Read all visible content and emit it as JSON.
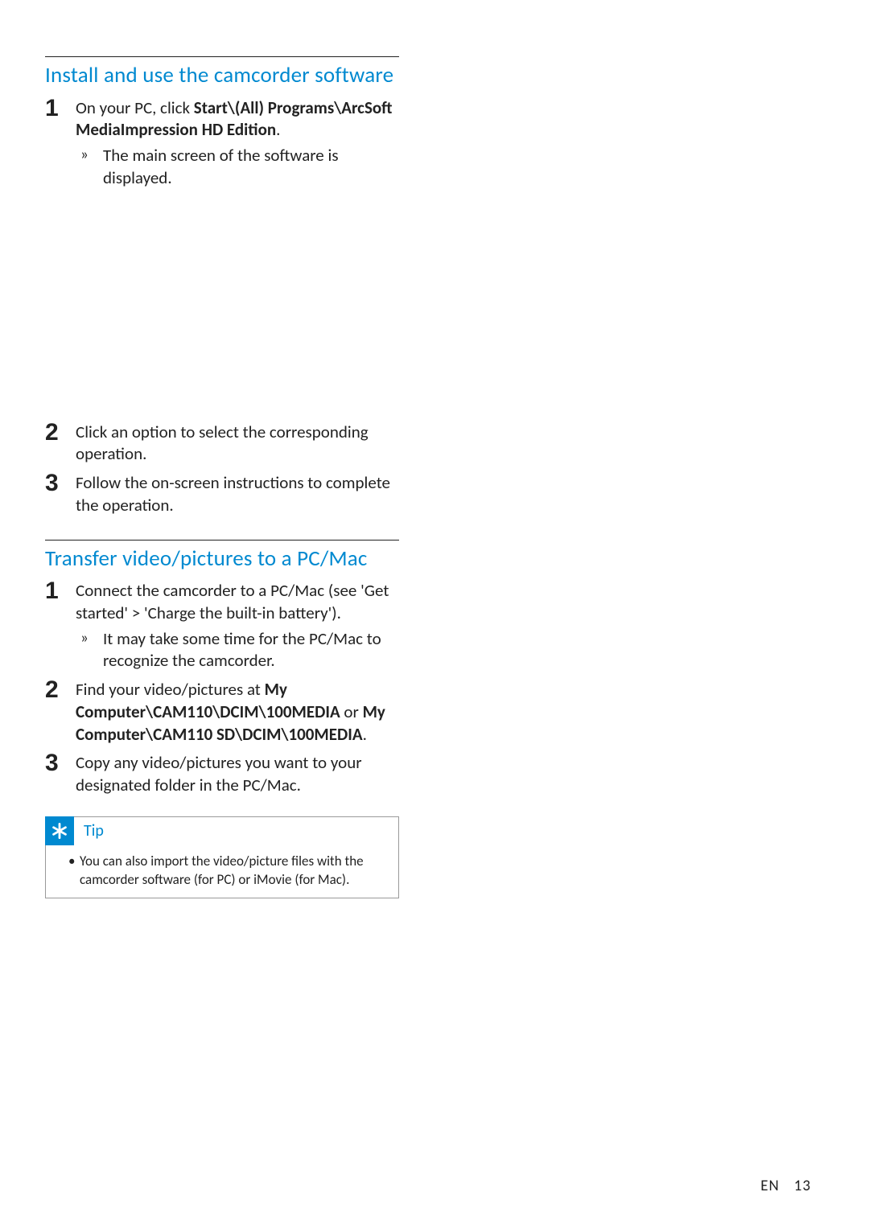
{
  "section1": {
    "heading": "Install and use the camcorder software",
    "steps": [
      {
        "pre": "On your PC, click ",
        "bold1": "Start\\(All) Programs\\ArcSoft MediaImpression HD Edition",
        "post": ".",
        "sub": "The main screen of the software is displayed."
      },
      {
        "text": "Click an option to select the corresponding operation."
      },
      {
        "text": "Follow the on-screen instructions to complete the operation."
      }
    ]
  },
  "section2": {
    "heading": "Transfer video/pictures to a PC/Mac",
    "steps": [
      {
        "text": "Connect the camcorder to a PC/Mac (see 'Get started' > 'Charge the built-in battery').",
        "sub": "It may take some time for the PC/Mac to recognize the camcorder."
      },
      {
        "pre": "Find your video/pictures at ",
        "bold1": "My Computer\\CAM110\\DCIM\\100MEDIA",
        "mid": " or ",
        "bold2": "My Computer\\CAM110 SD\\DCIM\\100MEDIA",
        "post": "."
      },
      {
        "text": "Copy any video/pictures you want to your designated folder in the PC/Mac."
      }
    ]
  },
  "tip": {
    "label": "Tip",
    "text": "You can also import the video/picture files with the camcorder software (for PC) or iMovie (for Mac)."
  },
  "footer": {
    "lang": "EN",
    "page": "13"
  }
}
